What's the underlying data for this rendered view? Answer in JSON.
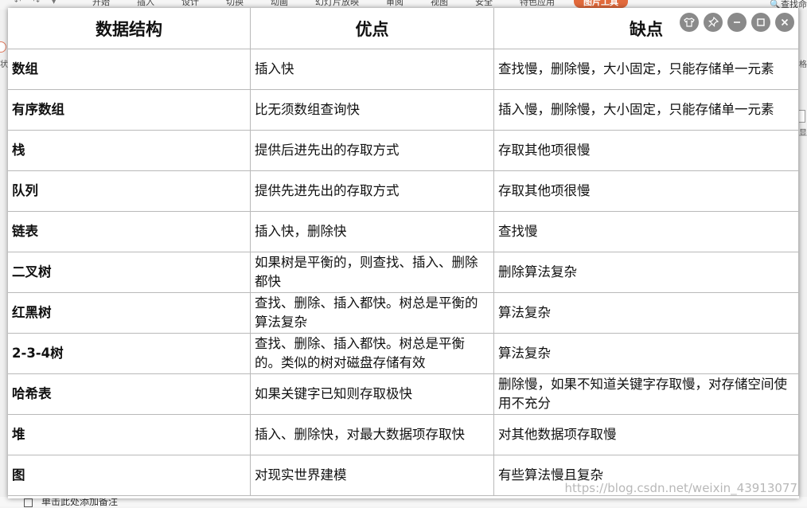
{
  "background": {
    "ribbon_tabs": [
      "开始",
      "插入",
      "设计",
      "切换",
      "动画",
      "幻灯片放映",
      "审阅",
      "视图",
      "安全",
      "特色应用"
    ],
    "ribbon_active_tab": "图片工具",
    "search_label": "查找命",
    "left_edge_text": "状",
    "right_edge_text1": "格",
    "right_edge_text2": "显",
    "notes_placeholder": "单击此处添加备注"
  },
  "table": {
    "headers": [
      "数据结构",
      "优点",
      "缺点"
    ],
    "rows": [
      {
        "name": "数组",
        "pros": "插入快",
        "cons": "查找慢，删除慢，大小固定，只能存储单一元素"
      },
      {
        "name": "有序数组",
        "pros": "比无须数组查询快",
        "cons": "插入慢，删除慢，大小固定，只能存储单一元素"
      },
      {
        "name": "栈",
        "pros": "提供后进先出的存取方式",
        "cons": "存取其他项很慢"
      },
      {
        "name": "队列",
        "pros": "提供先进先出的存取方式",
        "cons": "存取其他项很慢"
      },
      {
        "name": "链表",
        "pros": "插入快，删除快",
        "cons": "查找慢"
      },
      {
        "name": "二叉树",
        "pros": "如果树是平衡的，则查找、插入、删除都快",
        "cons": "删除算法复杂"
      },
      {
        "name": "红黑树",
        "pros": "查找、删除、插入都快。树总是平衡的算法复杂",
        "cons": "算法复杂"
      },
      {
        "name": "2-3-4树",
        "pros": "查找、删除、插入都快。树总是平衡的。类似的树对磁盘存储有效",
        "cons": "算法复杂"
      },
      {
        "name": "哈希表",
        "pros": "如果关键字已知则存取极快",
        "cons": "删除慢，如果不知道关键字存取慢，对存储空间使用不充分"
      },
      {
        "name": "堆",
        "pros": "插入、删除快，对最大数据项存取快",
        "cons": "对其他数据项存取慢"
      },
      {
        "name": "图",
        "pros": "对现实世界建模",
        "cons": "有些算法慢且复杂"
      }
    ]
  },
  "viewer_controls": [
    {
      "name": "shirt-icon"
    },
    {
      "name": "pin-icon"
    },
    {
      "name": "minimize-icon"
    },
    {
      "name": "maximize-icon"
    },
    {
      "name": "close-icon"
    }
  ],
  "watermark": "https://blog.csdn.net/weixin_43913077"
}
